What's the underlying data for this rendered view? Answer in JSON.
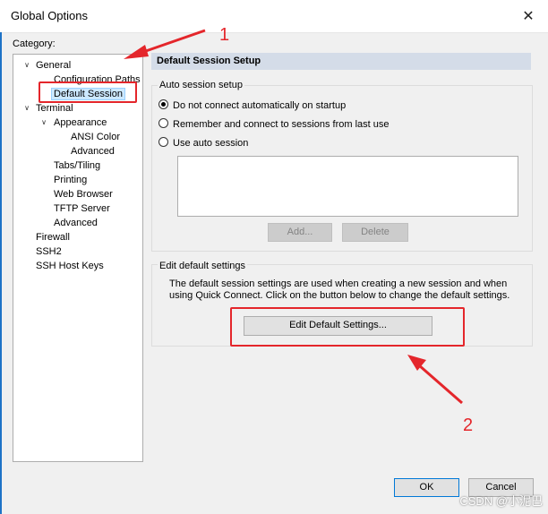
{
  "window": {
    "title": "Global Options",
    "close_glyph": "✕"
  },
  "category": {
    "label": "Category:",
    "tree": [
      {
        "label": "General",
        "toggle": "∨",
        "level": 0
      },
      {
        "label": "Configuration Paths",
        "level": 1
      },
      {
        "label": "Default Session",
        "level": 1,
        "selected": true
      },
      {
        "label": "Terminal",
        "toggle": "∨",
        "level": 0
      },
      {
        "label": "Appearance",
        "toggle": "∨",
        "level": 1
      },
      {
        "label": "ANSI Color",
        "level": 2
      },
      {
        "label": "Advanced",
        "level": 2
      },
      {
        "label": "Tabs/Tiling",
        "level": 1
      },
      {
        "label": "Printing",
        "level": 1
      },
      {
        "label": "Web Browser",
        "level": 1
      },
      {
        "label": "TFTP Server",
        "level": 1
      },
      {
        "label": "Advanced",
        "level": 1
      },
      {
        "label": "Firewall",
        "level": 0
      },
      {
        "label": "SSH2",
        "level": 0
      },
      {
        "label": "SSH Host Keys",
        "level": 0
      }
    ]
  },
  "panel": {
    "header": "Default Session Setup",
    "auto_session": {
      "title": "Auto session setup",
      "options": [
        {
          "label": "Do not connect automatically on startup",
          "checked": true
        },
        {
          "label": "Remember and connect to sessions from last use",
          "checked": false
        },
        {
          "label": "Use auto session",
          "checked": false
        }
      ],
      "add_button": "Add...",
      "delete_button": "Delete"
    },
    "edit_defaults": {
      "title": "Edit default settings",
      "description": "The default session settings are used when creating a new session and when using Quick Connect.  Click on the button below to change the default settings.",
      "button": "Edit Default Settings..."
    }
  },
  "footer": {
    "ok": "OK",
    "cancel": "Cancel"
  },
  "annotations": {
    "number_1": "1",
    "number_2": "2",
    "color": "#e4262b"
  },
  "watermark": "CSDN @小泥巴",
  "colors": {
    "header_bar": "#d4dce8",
    "selection": "#cce8ff",
    "accent": "#0078d7"
  }
}
